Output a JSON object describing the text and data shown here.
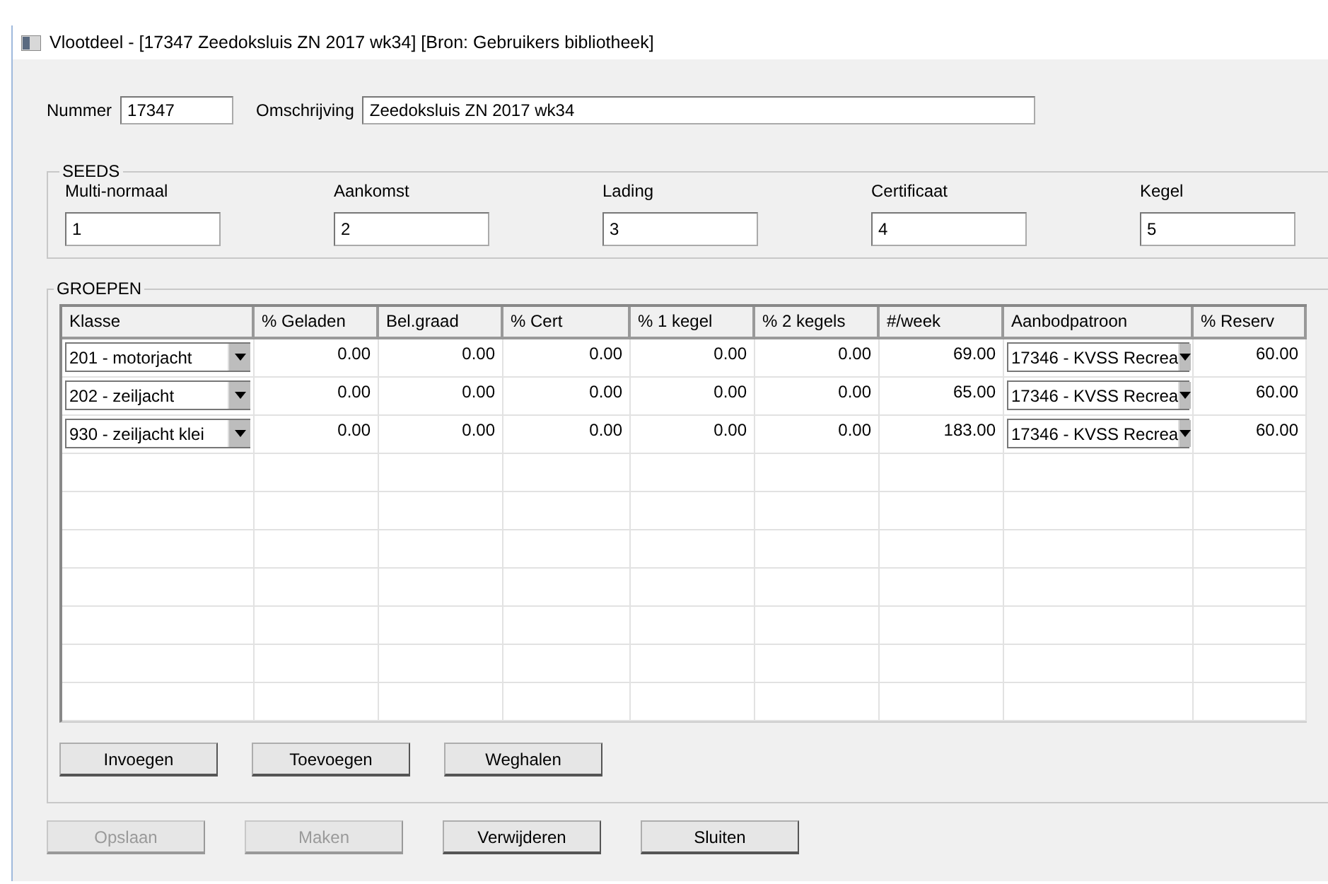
{
  "window": {
    "title": "Vlootdeel - [17347 Zeedoksluis ZN 2017 wk34] [Bron: Gebruikers bibliotheek]"
  },
  "fields": [
    {
      "label": "Nummer",
      "value": "17347",
      "kind": "short"
    },
    {
      "label": "Omschrijving",
      "value": "Zeedoksluis ZN 2017 wk34",
      "kind": "long"
    }
  ],
  "seeds": {
    "title": "SEEDS",
    "fields": [
      {
        "label": "Multi-normaal",
        "value": "1"
      },
      {
        "label": "Aankomst",
        "value": "2"
      },
      {
        "label": "Lading",
        "value": "3"
      },
      {
        "label": "Certificaat",
        "value": "4"
      },
      {
        "label": "Kegel",
        "value": "5"
      }
    ]
  },
  "groepen": {
    "title": "GROEPEN",
    "table": {
      "columns": [
        "Klasse",
        "% Geladen",
        "Bel.graad",
        "% Cert",
        "% 1 kegel",
        "% 2 kegels",
        "#/week",
        "Aanbodpatroon",
        "% Reserv"
      ],
      "rows": [
        [
          {
            "kind": "combo",
            "text": "201 - motorjacht"
          },
          {
            "kind": "number",
            "text": "0.00"
          },
          {
            "kind": "number",
            "text": "0.00"
          },
          {
            "kind": "number",
            "text": "0.00"
          },
          {
            "kind": "number",
            "text": "0.00"
          },
          {
            "kind": "number",
            "text": "0.00"
          },
          {
            "kind": "number",
            "text": "69.00"
          },
          {
            "kind": "combo",
            "text": "17346 - KVSS Recrea"
          },
          {
            "kind": "number",
            "text": "60.00"
          }
        ],
        [
          {
            "kind": "combo",
            "text": "202 - zeiljacht"
          },
          {
            "kind": "number",
            "text": "0.00"
          },
          {
            "kind": "number",
            "text": "0.00"
          },
          {
            "kind": "number",
            "text": "0.00"
          },
          {
            "kind": "number",
            "text": "0.00"
          },
          {
            "kind": "number",
            "text": "0.00"
          },
          {
            "kind": "number",
            "text": "65.00"
          },
          {
            "kind": "combo",
            "text": "17346 - KVSS Recrea"
          },
          {
            "kind": "number",
            "text": "60.00"
          }
        ],
        [
          {
            "kind": "combo",
            "text": "930 - zeiljacht klei"
          },
          {
            "kind": "number",
            "text": "0.00"
          },
          {
            "kind": "number",
            "text": "0.00"
          },
          {
            "kind": "number",
            "text": "0.00"
          },
          {
            "kind": "number",
            "text": "0.00"
          },
          {
            "kind": "number",
            "text": "0.00"
          },
          {
            "kind": "number",
            "text": "183.00"
          },
          {
            "kind": "combo",
            "text": "17346 - KVSS Recrea"
          },
          {
            "kind": "number",
            "text": "60.00"
          }
        ]
      ]
    },
    "buttons": [
      {
        "label": "Invoegen",
        "disabled": false
      },
      {
        "label": "Toevoegen",
        "disabled": false
      },
      {
        "label": "Weghalen",
        "disabled": false
      }
    ]
  },
  "buttons": [
    {
      "label": "Opslaan",
      "disabled": true
    },
    {
      "label": "Maken",
      "disabled": true
    },
    {
      "label": "Verwijderen",
      "disabled": false
    },
    {
      "label": "Sluiten",
      "disabled": false
    }
  ]
}
